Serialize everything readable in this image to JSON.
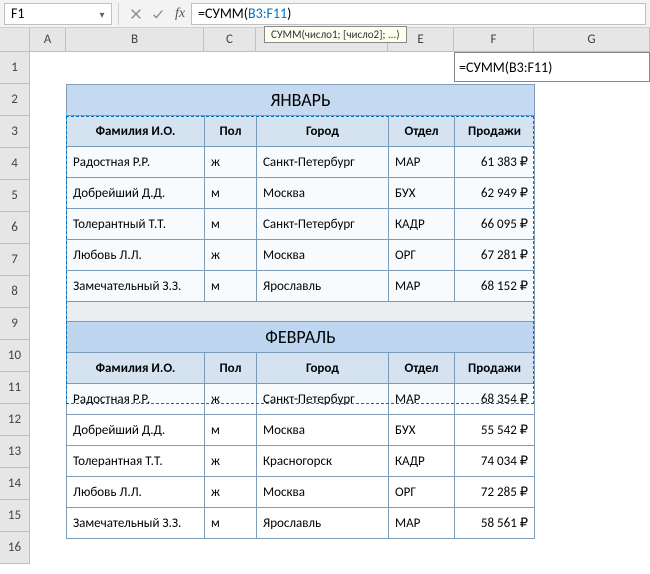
{
  "formula_bar": {
    "name_box": "F1",
    "formula_prefix": "=",
    "formula_fn": "СУММ",
    "formula_open": "(",
    "formula_ref": "B3:F11",
    "formula_close": ")",
    "tooltip": "СУММ(число1; [число2]; ...)"
  },
  "columns": [
    "A",
    "B",
    "C",
    "D",
    "E",
    "F",
    "G"
  ],
  "rows": [
    "1",
    "2",
    "3",
    "4",
    "5",
    "6",
    "7",
    "8",
    "9",
    "10",
    "11",
    "12",
    "13",
    "14",
    "15",
    "16"
  ],
  "active_cell_display": "=СУММ(B3:F11)",
  "table": {
    "month1": "ЯНВАРЬ",
    "month2": "ФЕВРАЛЬ",
    "headers": {
      "name": "Фамилия И.О.",
      "sex": "Пол",
      "city": "Город",
      "dept": "Отдел",
      "sales": "Продажи"
    },
    "rows1": [
      {
        "name": "Радостная Р.Р.",
        "sex": "ж",
        "city": "Санкт-Петербург",
        "dept": "МАР",
        "sales": "61 383 ₽"
      },
      {
        "name": "Добрейший Д.Д.",
        "sex": "м",
        "city": "Москва",
        "dept": "БУХ",
        "sales": "62 949 ₽"
      },
      {
        "name": "Толерантный Т.Т.",
        "sex": "м",
        "city": "Санкт-Петербург",
        "dept": "КАДР",
        "sales": "66 095 ₽"
      },
      {
        "name": "Любовь Л.Л.",
        "sex": "ж",
        "city": "Москва",
        "dept": "ОРГ",
        "sales": "67 281 ₽"
      },
      {
        "name": "Замечательный З.З.",
        "sex": "м",
        "city": "Ярославль",
        "dept": "МАР",
        "sales": "68 152 ₽"
      }
    ],
    "rows2": [
      {
        "name": "Радостная Р.Р.",
        "sex": "ж",
        "city": "Санкт-Петербург",
        "dept": "МАР",
        "sales": "68 354 ₽"
      },
      {
        "name": "Добрейший Д.Д.",
        "sex": "м",
        "city": "Москва",
        "dept": "БУХ",
        "sales": "55 542 ₽"
      },
      {
        "name": "Толерантная Т.Т.",
        "sex": "ж",
        "city": "Красногорск",
        "dept": "КАДР",
        "sales": "74 034 ₽"
      },
      {
        "name": "Любовь Л.Л.",
        "sex": "ж",
        "city": "Москва",
        "dept": "ОРГ",
        "sales": "72 285 ₽"
      },
      {
        "name": "Замечательный З.З.",
        "sex": "м",
        "city": "Ярославль",
        "dept": "МАР",
        "sales": "58 561 ₽"
      }
    ]
  }
}
